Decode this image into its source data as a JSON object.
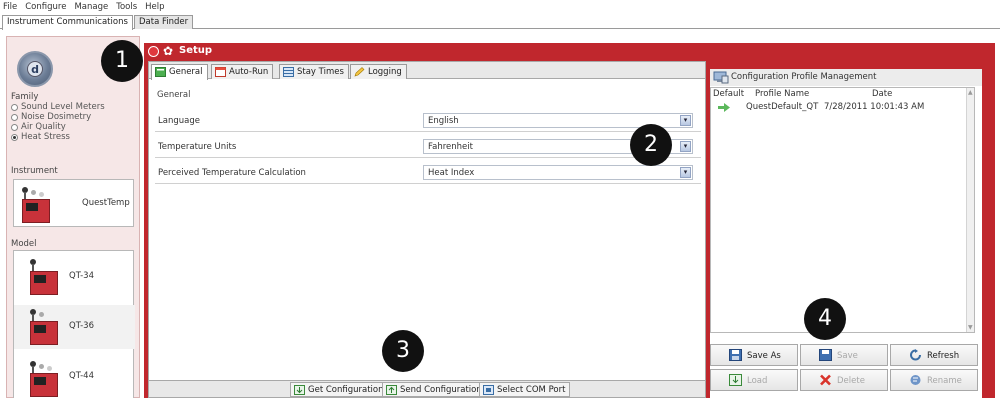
{
  "menu": [
    "File",
    "Configure",
    "Manage",
    "Tools",
    "Help"
  ],
  "top_tabs": [
    "Instrument Communications",
    "Data Finder"
  ],
  "left": {
    "family_label": "Family",
    "families": [
      {
        "label": "Sound Level Meters",
        "selected": false
      },
      {
        "label": "Noise Dosimetry",
        "selected": false
      },
      {
        "label": "Air Quality",
        "selected": false
      },
      {
        "label": "Heat Stress",
        "selected": true
      }
    ],
    "instrument_label": "Instrument",
    "instrument_name": "QuestTemp",
    "model_label": "Model",
    "models": [
      "QT-34",
      "QT-36",
      "QT-44"
    ]
  },
  "setup": {
    "title": "Setup",
    "tabs": [
      "General",
      "Auto-Run",
      "Stay Times",
      "Logging"
    ],
    "general_heading": "General",
    "rows": [
      {
        "label": "Language",
        "value": "English"
      },
      {
        "label": "Temperature Units",
        "value": "Fahrenheit"
      },
      {
        "label": "Perceived Temperature Calculation",
        "value": "Heat Index"
      }
    ],
    "bottom_buttons": [
      "Get Configuration",
      "Send Configuration",
      "Select COM Port"
    ]
  },
  "config": {
    "title": "Configuration Profile Management",
    "columns": [
      "Default",
      "Profile Name",
      "Date"
    ],
    "profile": {
      "name": "QuestDefault_QT",
      "date": "7/28/2011 10:01:43 AM"
    },
    "buttons_row1": [
      "Save As",
      "Save",
      "Refresh"
    ],
    "buttons_row2": [
      "Load",
      "Delete",
      "Rename"
    ]
  },
  "callouts": [
    "1",
    "2",
    "3",
    "4"
  ],
  "colors": {
    "setup_accent": "#c0272d",
    "left_panel": "#f6e7e7"
  }
}
